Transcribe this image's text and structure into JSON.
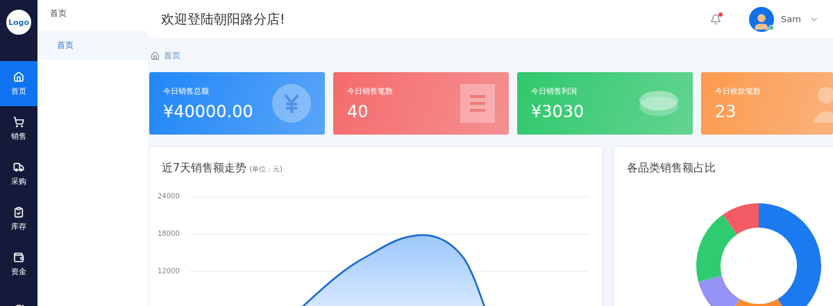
{
  "sidebar": {
    "logo": "Logo",
    "items": [
      {
        "label": "首页",
        "selected": true
      },
      {
        "label": "销售",
        "selected": false
      },
      {
        "label": "采购",
        "selected": false
      },
      {
        "label": "库存",
        "selected": false
      },
      {
        "label": "资金",
        "selected": false
      },
      {
        "selected": false
      }
    ]
  },
  "submenu": {
    "title": "首页",
    "items": [
      {
        "label": "首页",
        "selected": true
      }
    ]
  },
  "header": {
    "title": "欢迎登陆朝阳路分店!",
    "notification": true,
    "user": "Sam",
    "online": true
  },
  "breadcrumb": [
    "首页"
  ],
  "stats": [
    {
      "label": "今日销售总额",
      "value": "¥40000.00",
      "color": "#2187f7"
    },
    {
      "label": "今日销售笔数",
      "value": "40",
      "color": "#f56b6b"
    },
    {
      "label": "今日销售利润",
      "value": "¥3030",
      "color": "#2fc86c"
    },
    {
      "label": "今日收款笔数",
      "value": "23",
      "color": "#fc9a4d"
    }
  ],
  "trend_panel": {
    "title": "近7天销售额走势",
    "unit": "(单位：元)",
    "y_axis_labels": [
      "24000",
      "18000",
      "12000"
    ]
  },
  "category_panel": {
    "title": "各品类销售额占比"
  }
}
